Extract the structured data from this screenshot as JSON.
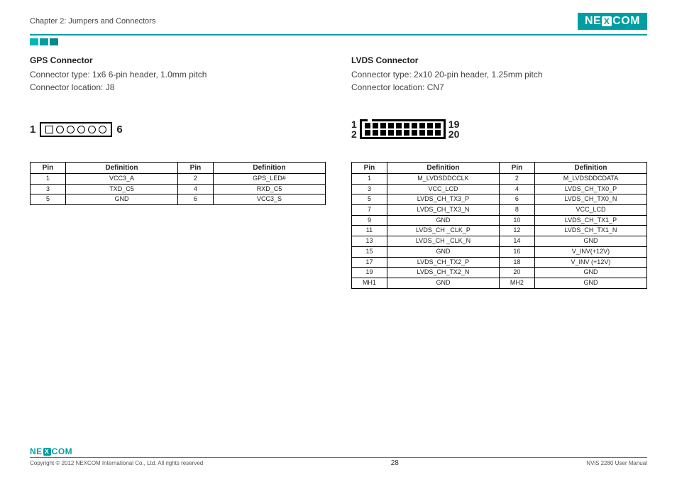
{
  "header": {
    "chapter": "Chapter 2: Jumpers and Connectors",
    "logo_pre": "NE",
    "logo_x": "X",
    "logo_post": "COM"
  },
  "left": {
    "title": "GPS Connector",
    "type_line": "Connector type: 1x6 6-pin header, 1.0mm pitch",
    "loc_line": "Connector location: J8",
    "diag_left": "1",
    "diag_right": "6",
    "table": {
      "headers": [
        "Pin",
        "Definition",
        "Pin",
        "Definition"
      ],
      "rows": [
        [
          "1",
          "VCC3_A",
          "2",
          "GPS_LED#"
        ],
        [
          "3",
          "TXD_C5",
          "4",
          "RXD_C5"
        ],
        [
          "5",
          "GND",
          "6",
          "VCC3_S"
        ]
      ]
    }
  },
  "right": {
    "title": "LVDS Connector",
    "type_line": "Connector type: 2x10 20-pin header, 1.25mm pitch",
    "loc_line": "Connector location: CN7",
    "diag_tl": "1",
    "diag_bl": "2",
    "diag_tr": "19",
    "diag_br": "20",
    "table": {
      "headers": [
        "Pin",
        "Definition",
        "Pin",
        "Definition"
      ],
      "rows": [
        [
          "1",
          "M_LVDSDDCCLK",
          "2",
          "M_LVDSDDCDATA"
        ],
        [
          "3",
          "VCC_LCD",
          "4",
          "LVDS_CH_TX0_P"
        ],
        [
          "5",
          "LVDS_CH_TX3_P",
          "6",
          "LVDS_CH_TX0_N"
        ],
        [
          "7",
          "LVDS_CH_TX3_N",
          "8",
          "VCC_LCD"
        ],
        [
          "9",
          "GND",
          "10",
          "LVDS_CH_TX1_P"
        ],
        [
          "11",
          "LVDS_CH _CLK_P",
          "12",
          "LVDS_CH_TX1_N"
        ],
        [
          "13",
          "LVDS_CH _CLK_N",
          "14",
          "GND"
        ],
        [
          "15",
          "GND",
          "16",
          "V_INV(+12V)"
        ],
        [
          "17",
          "LVDS_CH_TX2_P",
          "18",
          "V_INV (+12V)"
        ],
        [
          "19",
          "LVDS_CH_TX2_N",
          "20",
          "GND"
        ],
        [
          "MH1",
          "GND",
          "MH2",
          "GND"
        ]
      ]
    }
  },
  "footer": {
    "copyright": "Copyright © 2012 NEXCOM International Co., Ltd. All rights reserved",
    "page": "28",
    "manual": "NViS 2280 User Manual"
  }
}
